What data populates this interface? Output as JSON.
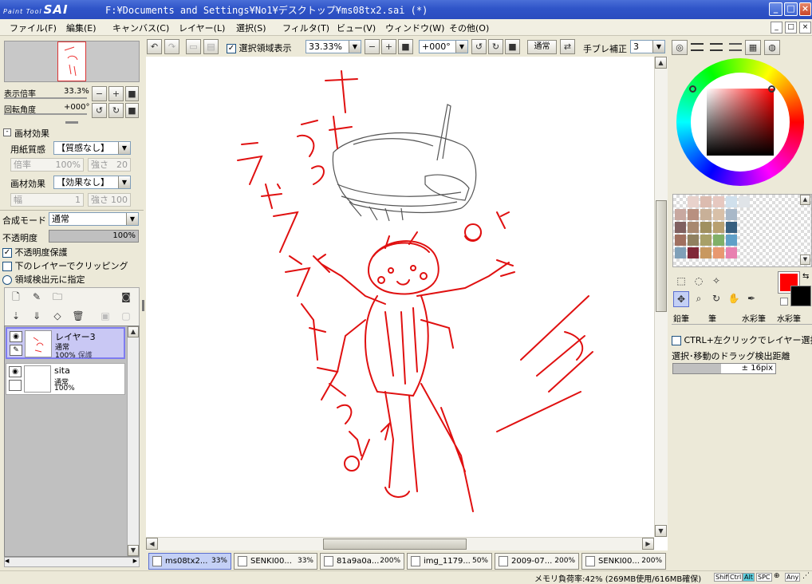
{
  "app": {
    "logo_small": "Paint Tool",
    "logo_big": "SAI",
    "title": "F:¥Documents and Settings¥No1¥デスクトップ¥ms08tx2.sai (*)"
  },
  "menu": [
    "ファイル(F)",
    "編集(E)",
    "キャンバス(C)",
    "レイヤー(L)",
    "選択(S)",
    "フィルタ(T)",
    "ビュー(V)",
    "ウィンドウ(W)",
    "その他(O)"
  ],
  "toolbar": {
    "selection_display_label": "選択領域表示",
    "zoom": "33.33%",
    "angle": "+000°",
    "blend_mode": "通常",
    "stabilizer_label": "手ブレ補正",
    "stabilizer_value": "3"
  },
  "navigator": {
    "zoom_label": "表示倍率",
    "zoom_value": "33.3%",
    "rotate_label": "回転角度",
    "rotate_value": "+000°"
  },
  "texture": {
    "header": "画材効果",
    "paper_label": "用紙質感",
    "paper_value": "【質感なし】",
    "scale_label": "倍率",
    "scale_value": "100%",
    "strength_label": "強さ",
    "strength_value": "20",
    "effect_label": "画材効果",
    "effect_value": "【効果なし】",
    "width_label": "幅",
    "width_value": "1",
    "effect_strength_label": "強さ",
    "effect_strength_value": "100"
  },
  "layer_props": {
    "blend_label": "合成モード",
    "blend_value": "通常",
    "opacity_label": "不透明度",
    "opacity_value": "100%",
    "protect_label": "不透明度保護",
    "clip_label": "下のレイヤーでクリッピング",
    "selection_source_label": "領域検出元に指定"
  },
  "layers": [
    {
      "name": "レイヤー3",
      "mode": "通常",
      "opacity": "100%",
      "lock": "保護"
    },
    {
      "name": "sita",
      "mode": "通常",
      "opacity": "100%"
    }
  ],
  "right_panel": {
    "brush_tabs": [
      "鉛筆",
      "筆",
      "水彩筆",
      "水彩筆"
    ],
    "ctrl_label": "CTRL+左クリックでレイヤー選択",
    "drag_label": "選択･移動のドラッグ検出距離",
    "drag_value": "± 16pix",
    "primary_color": "#ff0000",
    "secondary_color": "#000000"
  },
  "palette": [
    "#ffffff",
    "#e8d2cc",
    "#dcbcb0",
    "#e6c8c0",
    "#d0e0ec",
    "#e0e4e8",
    "#ffffff",
    "#ffffff",
    "#ffffff",
    "#ffffff",
    "#c8a8a0",
    "#b89080",
    "#c8b098",
    "#d8c0a8",
    "#a8b8c8",
    "#ffffff",
    "#ffffff",
    "#ffffff",
    "#ffffff",
    "#ffffff",
    "#806060",
    "#a88870",
    "#a09060",
    "#b8a070",
    "#386080",
    "#ffffff",
    "#ffffff",
    "#ffffff",
    "#ffffff",
    "#ffffff",
    "#a07060",
    "#908060",
    "#a8a068",
    "#80b068",
    "#60a0c8",
    "#ffffff",
    "#ffffff",
    "#ffffff",
    "#ffffff",
    "#ffffff",
    "#80a0b8",
    "#802838",
    "#c89860",
    "#e89870",
    "#e880b0",
    "#ffffff",
    "#ffffff",
    "#ffffff",
    "#ffffff",
    "#ffffff"
  ],
  "tabs": [
    {
      "name": "ms08tx2...",
      "zoom": "33%"
    },
    {
      "name": "SENKI00...",
      "zoom": "33%"
    },
    {
      "name": "81a9a0a...",
      "zoom": "200%"
    },
    {
      "name": "img_1179...",
      "zoom": "50%"
    },
    {
      "name": "2009-07...",
      "zoom": "200%"
    },
    {
      "name": "SENKI00...",
      "zoom": "200%"
    }
  ],
  "status": {
    "memory": "メモリ負荷率:42% (269MB使用/616MB確保)",
    "keys": [
      "Shift",
      "Ctrl",
      "Alt",
      "SPC",
      "⊕",
      "Any"
    ]
  }
}
